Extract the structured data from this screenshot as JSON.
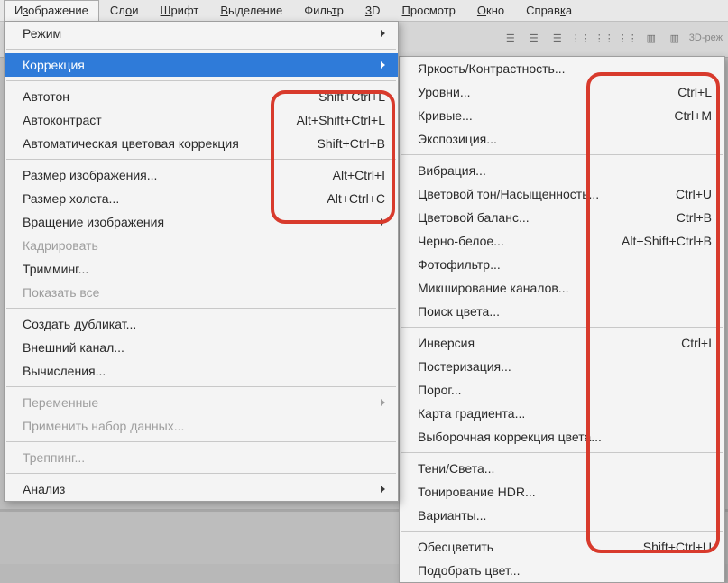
{
  "menubar": {
    "image": {
      "pre": "И",
      "mn": "з",
      "post": "ображение"
    },
    "layers": {
      "pre": "Сл",
      "mn": "о",
      "post": "и"
    },
    "type": {
      "pre": "",
      "mn": "Ш",
      "post": "рифт"
    },
    "select": {
      "pre": "",
      "mn": "В",
      "post": "ыделение"
    },
    "filter": {
      "pre": "Филь",
      "mn": "т",
      "post": "р"
    },
    "threeD": {
      "pre": "",
      "mn": "3",
      "post": "D"
    },
    "view": {
      "pre": "",
      "mn": "П",
      "post": "росмотр"
    },
    "window": {
      "pre": "",
      "mn": "О",
      "post": "кно"
    },
    "help": {
      "pre": "Справ",
      "mn": "к",
      "post": "а"
    }
  },
  "toolbar": {
    "threeD_mode": "3D-реж"
  },
  "imageMenu": {
    "mode": {
      "label": "Режим"
    },
    "adjust": {
      "label": "Коррекция"
    },
    "autotone": {
      "label": "Автотон",
      "sc": "Shift+Ctrl+L"
    },
    "autocontrast": {
      "label": "Автоконтраст",
      "sc": "Alt+Shift+Ctrl+L"
    },
    "autocolor": {
      "label": "Автоматическая цветовая коррекция",
      "sc": "Shift+Ctrl+B"
    },
    "imagesize": {
      "label": "Размер изображения...",
      "sc": "Alt+Ctrl+I"
    },
    "canvassize": {
      "label": "Размер холста...",
      "sc": "Alt+Ctrl+C"
    },
    "rotation": {
      "label": "Вращение изображения"
    },
    "crop": {
      "label": "Кадрировать"
    },
    "trim": {
      "label": "Тримминг..."
    },
    "revealall": {
      "label": "Показать все"
    },
    "duplicate": {
      "label": "Создать дубликат..."
    },
    "applyimage": {
      "label": "Внешний канал..."
    },
    "calculations": {
      "label": "Вычисления..."
    },
    "variables": {
      "label": "Переменные"
    },
    "applydata": {
      "label": "Применить набор данных..."
    },
    "trap": {
      "label": "Треппинг..."
    },
    "analysis": {
      "label": "Анализ"
    }
  },
  "adjustMenu": {
    "brightcontrast": {
      "label": "Яркость/Контрастность..."
    },
    "levels": {
      "label": "Уровни...",
      "sc": "Ctrl+L"
    },
    "curves": {
      "label": "Кривые...",
      "sc": "Ctrl+M"
    },
    "exposure": {
      "label": "Экспозиция..."
    },
    "vibrance": {
      "label": "Вибрация..."
    },
    "huesat": {
      "label": "Цветовой тон/Насыщенность...",
      "sc": "Ctrl+U"
    },
    "colorbalance": {
      "label": "Цветовой баланс...",
      "sc": "Ctrl+B"
    },
    "blackwhite": {
      "label": "Черно-белое...",
      "sc": "Alt+Shift+Ctrl+B"
    },
    "photofilter": {
      "label": "Фотофильтр..."
    },
    "channelmixer": {
      "label": "Микширование каналов..."
    },
    "colorlookup": {
      "label": "Поиск цвета..."
    },
    "invert": {
      "label": "Инверсия",
      "sc": "Ctrl+I"
    },
    "posterize": {
      "label": "Постеризация..."
    },
    "threshold": {
      "label": "Порог..."
    },
    "gradientmap": {
      "label": "Карта градиента..."
    },
    "selectivecolor": {
      "label": "Выборочная коррекция цвета..."
    },
    "shadowshigh": {
      "label": "Тени/Света..."
    },
    "hdrtoning": {
      "label": "Тонирование HDR..."
    },
    "variations": {
      "label": "Варианты..."
    },
    "desaturate": {
      "label": "Обесцветить",
      "sc": "Shift+Ctrl+U"
    },
    "matchcolor": {
      "label": "Подобрать цвет..."
    }
  }
}
